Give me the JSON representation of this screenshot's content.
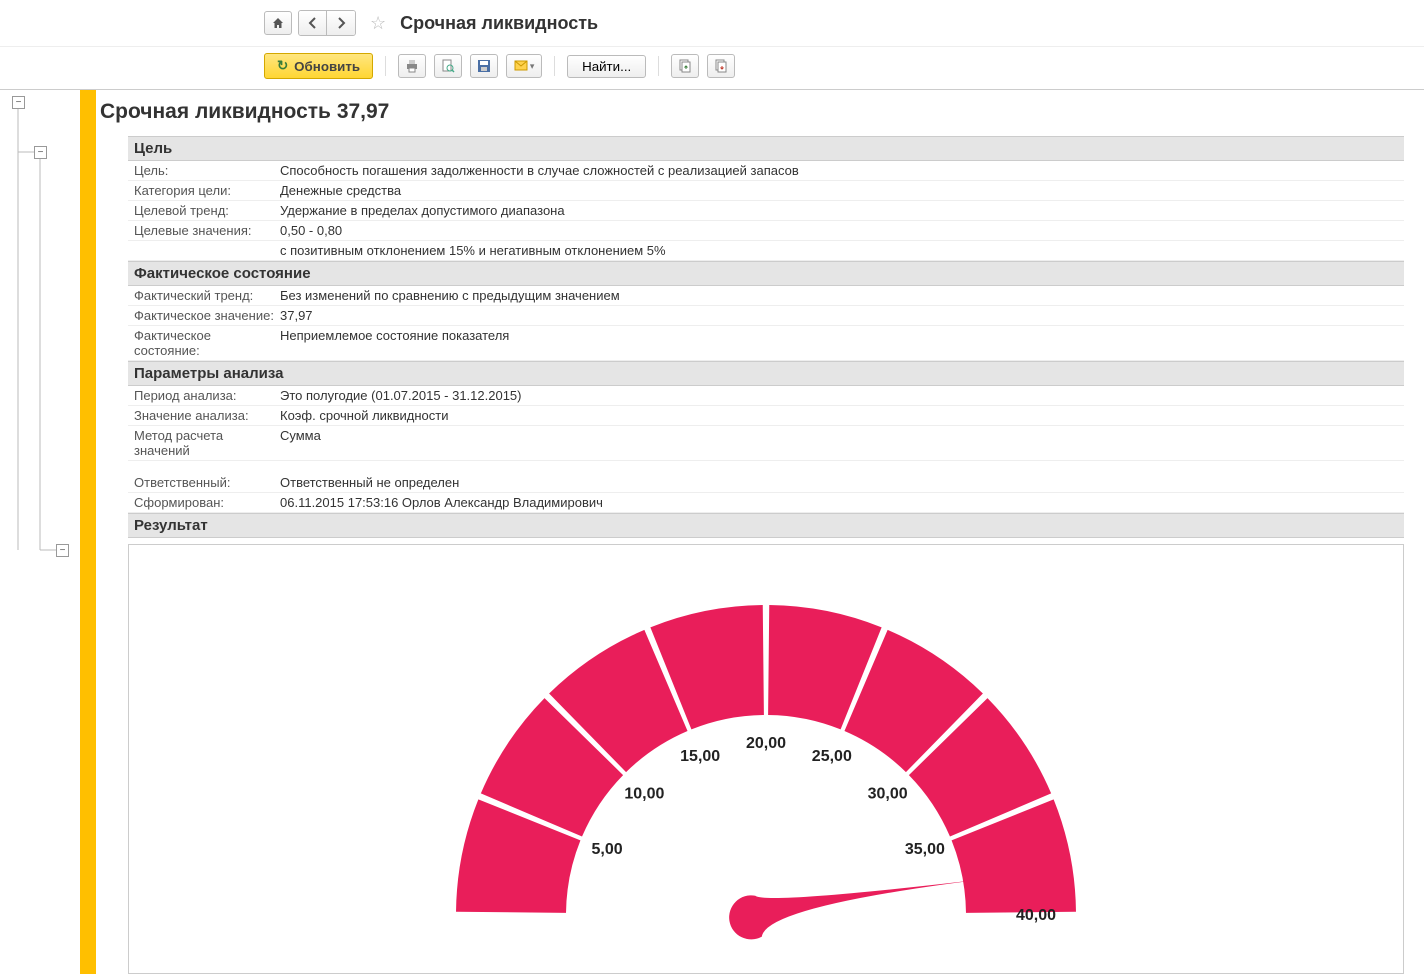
{
  "header": {
    "title": "Срочная ликвидность"
  },
  "toolbar": {
    "refresh": "Обновить",
    "find": "Найти..."
  },
  "report": {
    "title_prefix": "Срочная ликвидность",
    "title_value": "37,97",
    "sections": {
      "goal": {
        "header": "Цель",
        "rows": {
          "goal_label": "Цель:",
          "goal_value": "Способность погашения задолженности в случае сложностей с реализацией запасов",
          "category_label": "Категория цели:",
          "category_value": "Денежные средства",
          "trend_label": "Целевой тренд:",
          "trend_value": "Удержание в пределах допустимого диапазона",
          "target_label": "Целевые значения:",
          "target_value": "0,50 - 0,80",
          "target_sub": "с позитивным отклонением 15% и негативным отклонением 5%"
        }
      },
      "actual": {
        "header": "Фактическое состояние",
        "rows": {
          "trend_label": "Фактический тренд:",
          "trend_value": "Без изменений по сравнению с предыдущим значением",
          "value_label": "Фактическое значение:",
          "value_value": "37,97",
          "state_label": "Фактическое состояние:",
          "state_value": "Неприемлемое состояние показателя"
        }
      },
      "params": {
        "header": "Параметры анализа",
        "rows": {
          "period_label": "Период анализа:",
          "period_value": "Это полугодие (01.07.2015 - 31.12.2015)",
          "analysis_label": "Значение анализа:",
          "analysis_value": "Коэф. срочной ликвидности",
          "method_label": "Метод расчета значений",
          "method_value": "Сумма"
        }
      },
      "meta": {
        "responsible_label": "Ответственный:",
        "responsible_value": "Ответственный не определен",
        "generated_label": "Сформирован:",
        "generated_value": "06.11.2015 17:53:16 Орлов Александр Владимирович"
      },
      "result": {
        "header": "Результат"
      }
    }
  },
  "chart_data": {
    "type": "gauge",
    "min": 0,
    "max": 40,
    "ticks": [
      5.0,
      10.0,
      15.0,
      20.0,
      25.0,
      30.0,
      35.0,
      40.0
    ],
    "tick_labels": [
      "5,00",
      "10,00",
      "15,00",
      "20,00",
      "25,00",
      "30,00",
      "35,00",
      "40,00"
    ],
    "value": 37.97,
    "segments": 8,
    "color": "#e91e5a"
  }
}
